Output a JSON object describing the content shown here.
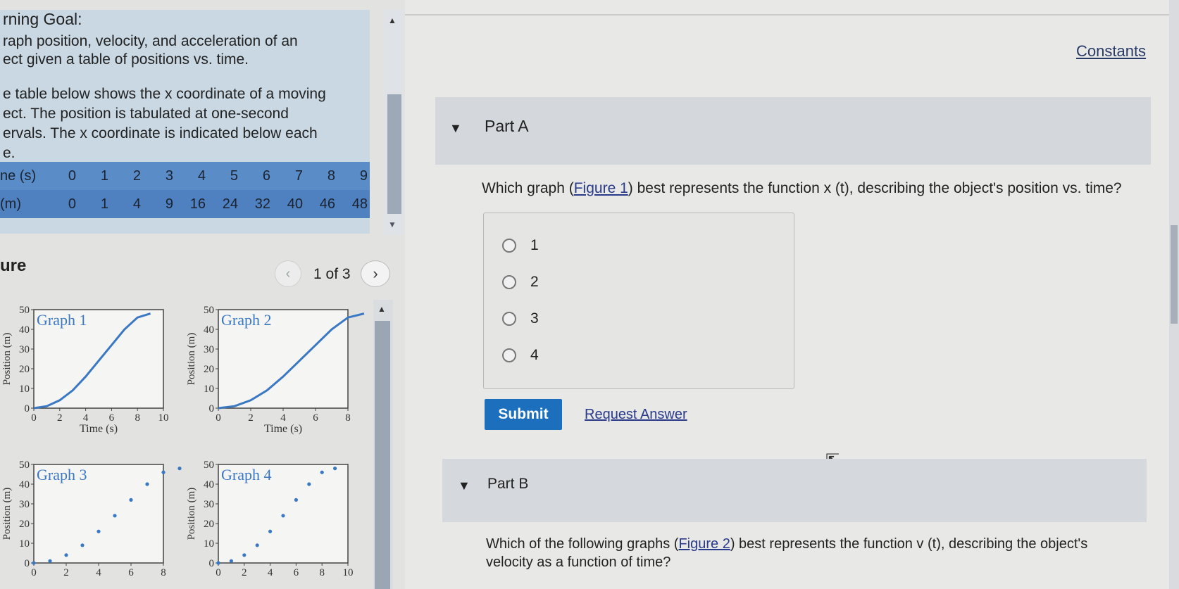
{
  "goal": {
    "title": "rning Goal:",
    "line1": "raph position, velocity, and acceleration of an",
    "line2": "ect given a table of positions vs. time."
  },
  "intro": {
    "line1": "e table below shows the x coordinate of a moving",
    "line2": "ect. The position is tabulated at one-second",
    "line3": "ervals. The x coordinate is indicated below each",
    "line4": "e."
  },
  "table": {
    "row_time_label": "ne (s)",
    "row_pos_label": "(m)",
    "times": [
      "0",
      "1",
      "2",
      "3",
      "4",
      "5",
      "6",
      "7",
      "8",
      "9"
    ],
    "positions": [
      "0",
      "1",
      "4",
      "9",
      "16",
      "24",
      "32",
      "40",
      "46",
      "48"
    ]
  },
  "figure": {
    "title": "ure",
    "counter": "1 of 3",
    "prev_icon": "chevron-left-icon",
    "next_icon": "chevron-right-icon"
  },
  "graphs": [
    {
      "label": "Graph 1",
      "ylabel": "Position (m)",
      "xlabel": "Time (s)",
      "yticks": [
        "50",
        "40",
        "30",
        "20",
        "10",
        "0"
      ],
      "xticks": [
        "0",
        "2",
        "4",
        "6",
        "8",
        "10"
      ]
    },
    {
      "label": "Graph 2",
      "ylabel": "Position (m)",
      "xlabel": "Time (s)",
      "yticks": [
        "50",
        "40",
        "30",
        "20",
        "10",
        "0"
      ],
      "xticks": [
        "0",
        "2",
        "4",
        "6",
        "8"
      ]
    },
    {
      "label": "Graph 3",
      "ylabel": "Position (m)",
      "xlabel": "",
      "yticks": [
        "50",
        "40",
        "30",
        "20",
        "10",
        "0"
      ],
      "xticks": [
        "0",
        "2",
        "4",
        "6",
        "8"
      ]
    },
    {
      "label": "Graph 4",
      "ylabel": "Position (m)",
      "xlabel": "",
      "yticks": [
        "50",
        "40",
        "30",
        "20",
        "10",
        "0"
      ],
      "xticks": [
        "0",
        "2",
        "4",
        "6",
        "8",
        "10"
      ]
    }
  ],
  "right": {
    "constants": "Constants",
    "partA": {
      "label": "Part A",
      "q_before": "Which graph (",
      "q_link": "Figure 1",
      "q_after": ") best represents the function x (t), describing the object's position vs. time?",
      "choices": [
        "1",
        "2",
        "3",
        "4"
      ],
      "submit": "Submit",
      "request": "Request Answer"
    },
    "partB": {
      "label": "Part B",
      "q_before": "Which of the following graphs (",
      "q_link": "Figure 2",
      "q_after": ") best represents the function v (t), describing the object's velocity as a function of time?"
    }
  },
  "colors": {
    "accent": "#1c6fbd",
    "curve": "#3b78c4",
    "table_row": "#5a8cc8"
  }
}
